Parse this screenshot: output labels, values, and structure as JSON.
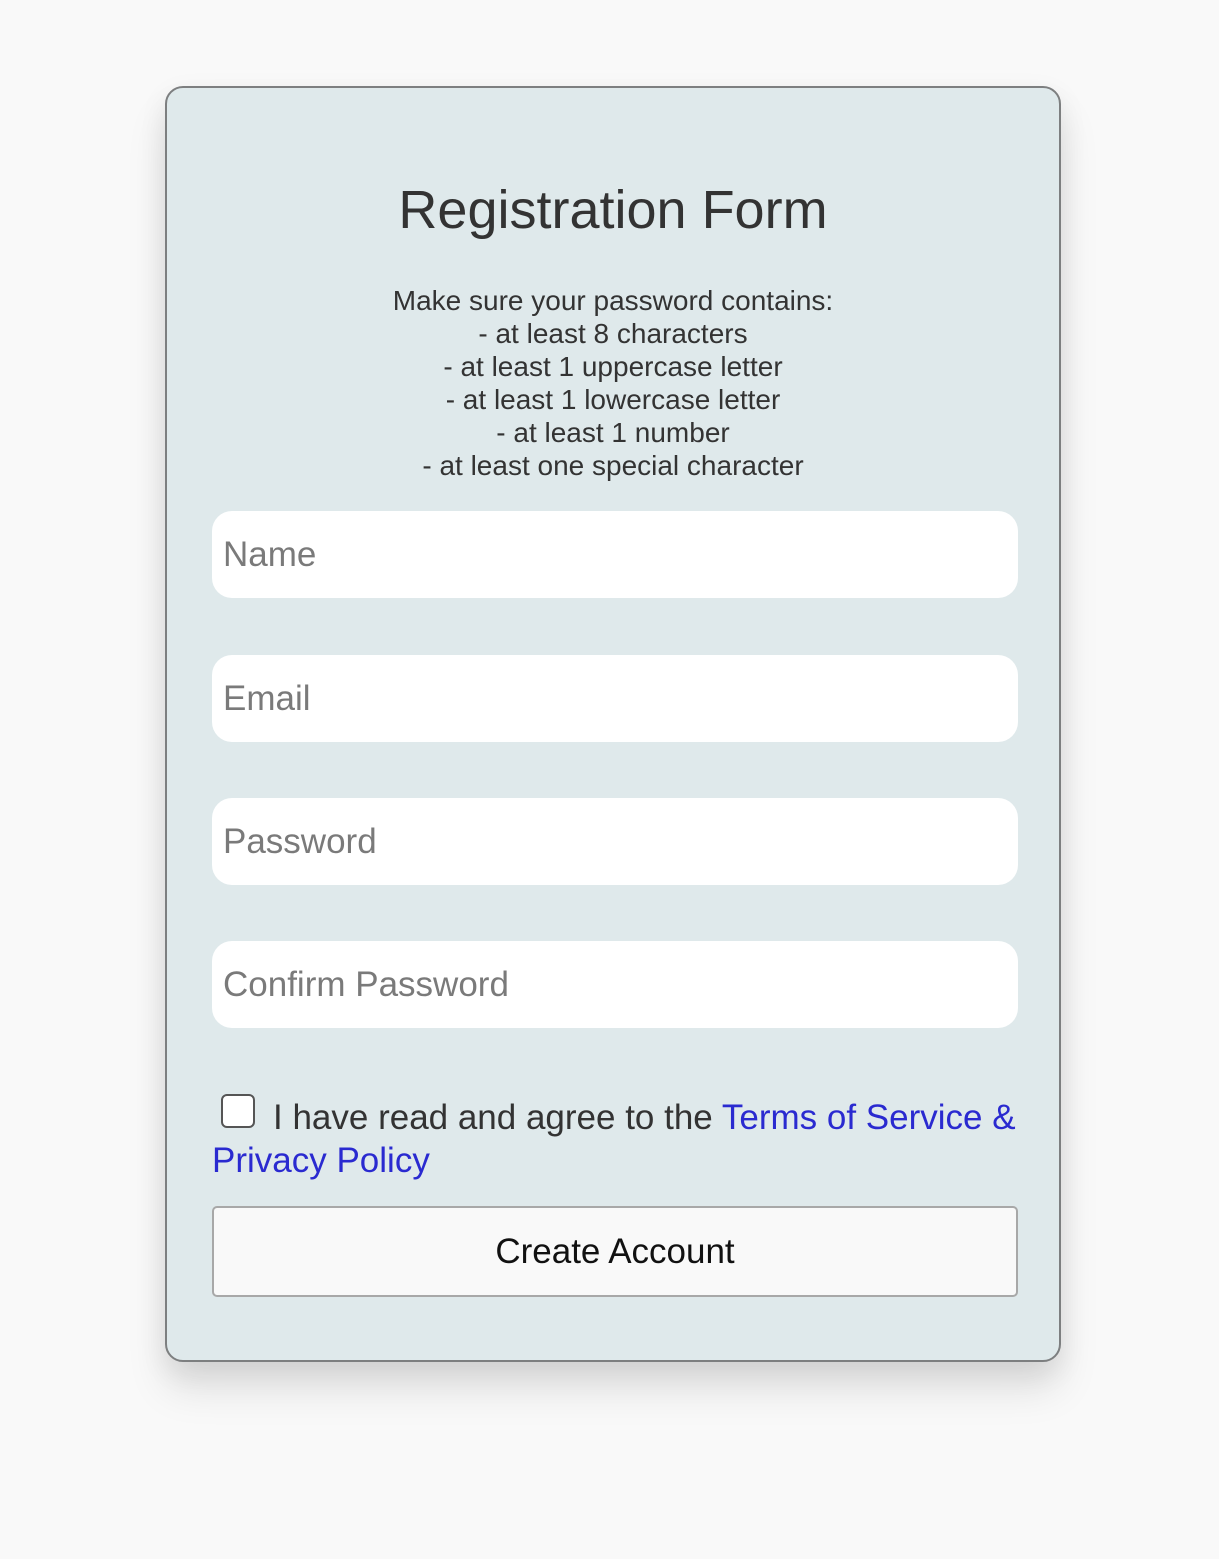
{
  "form": {
    "title": "Registration Form",
    "rules_intro": "Make sure your password contains:",
    "rules": [
      "- at least 8 characters",
      "- at least 1 uppercase letter",
      "- at least 1 lowercase letter",
      "- at least 1 number",
      "- at least one special character"
    ],
    "fields": {
      "name": {
        "placeholder": "Name",
        "value": ""
      },
      "email": {
        "placeholder": "Email",
        "value": ""
      },
      "password": {
        "placeholder": "Password",
        "value": ""
      },
      "confirm_password": {
        "placeholder": "Confirm Password",
        "value": ""
      }
    },
    "agreement": {
      "text": "I have read and agree to the ",
      "link_text": "Terms of Service & Privacy Policy",
      "checked": false
    },
    "submit_label": "Create Account"
  },
  "colors": {
    "page_background": "#f9f9f9",
    "card_background": "#dfe9eb",
    "link": "#2a2ad0",
    "text": "#333333"
  }
}
